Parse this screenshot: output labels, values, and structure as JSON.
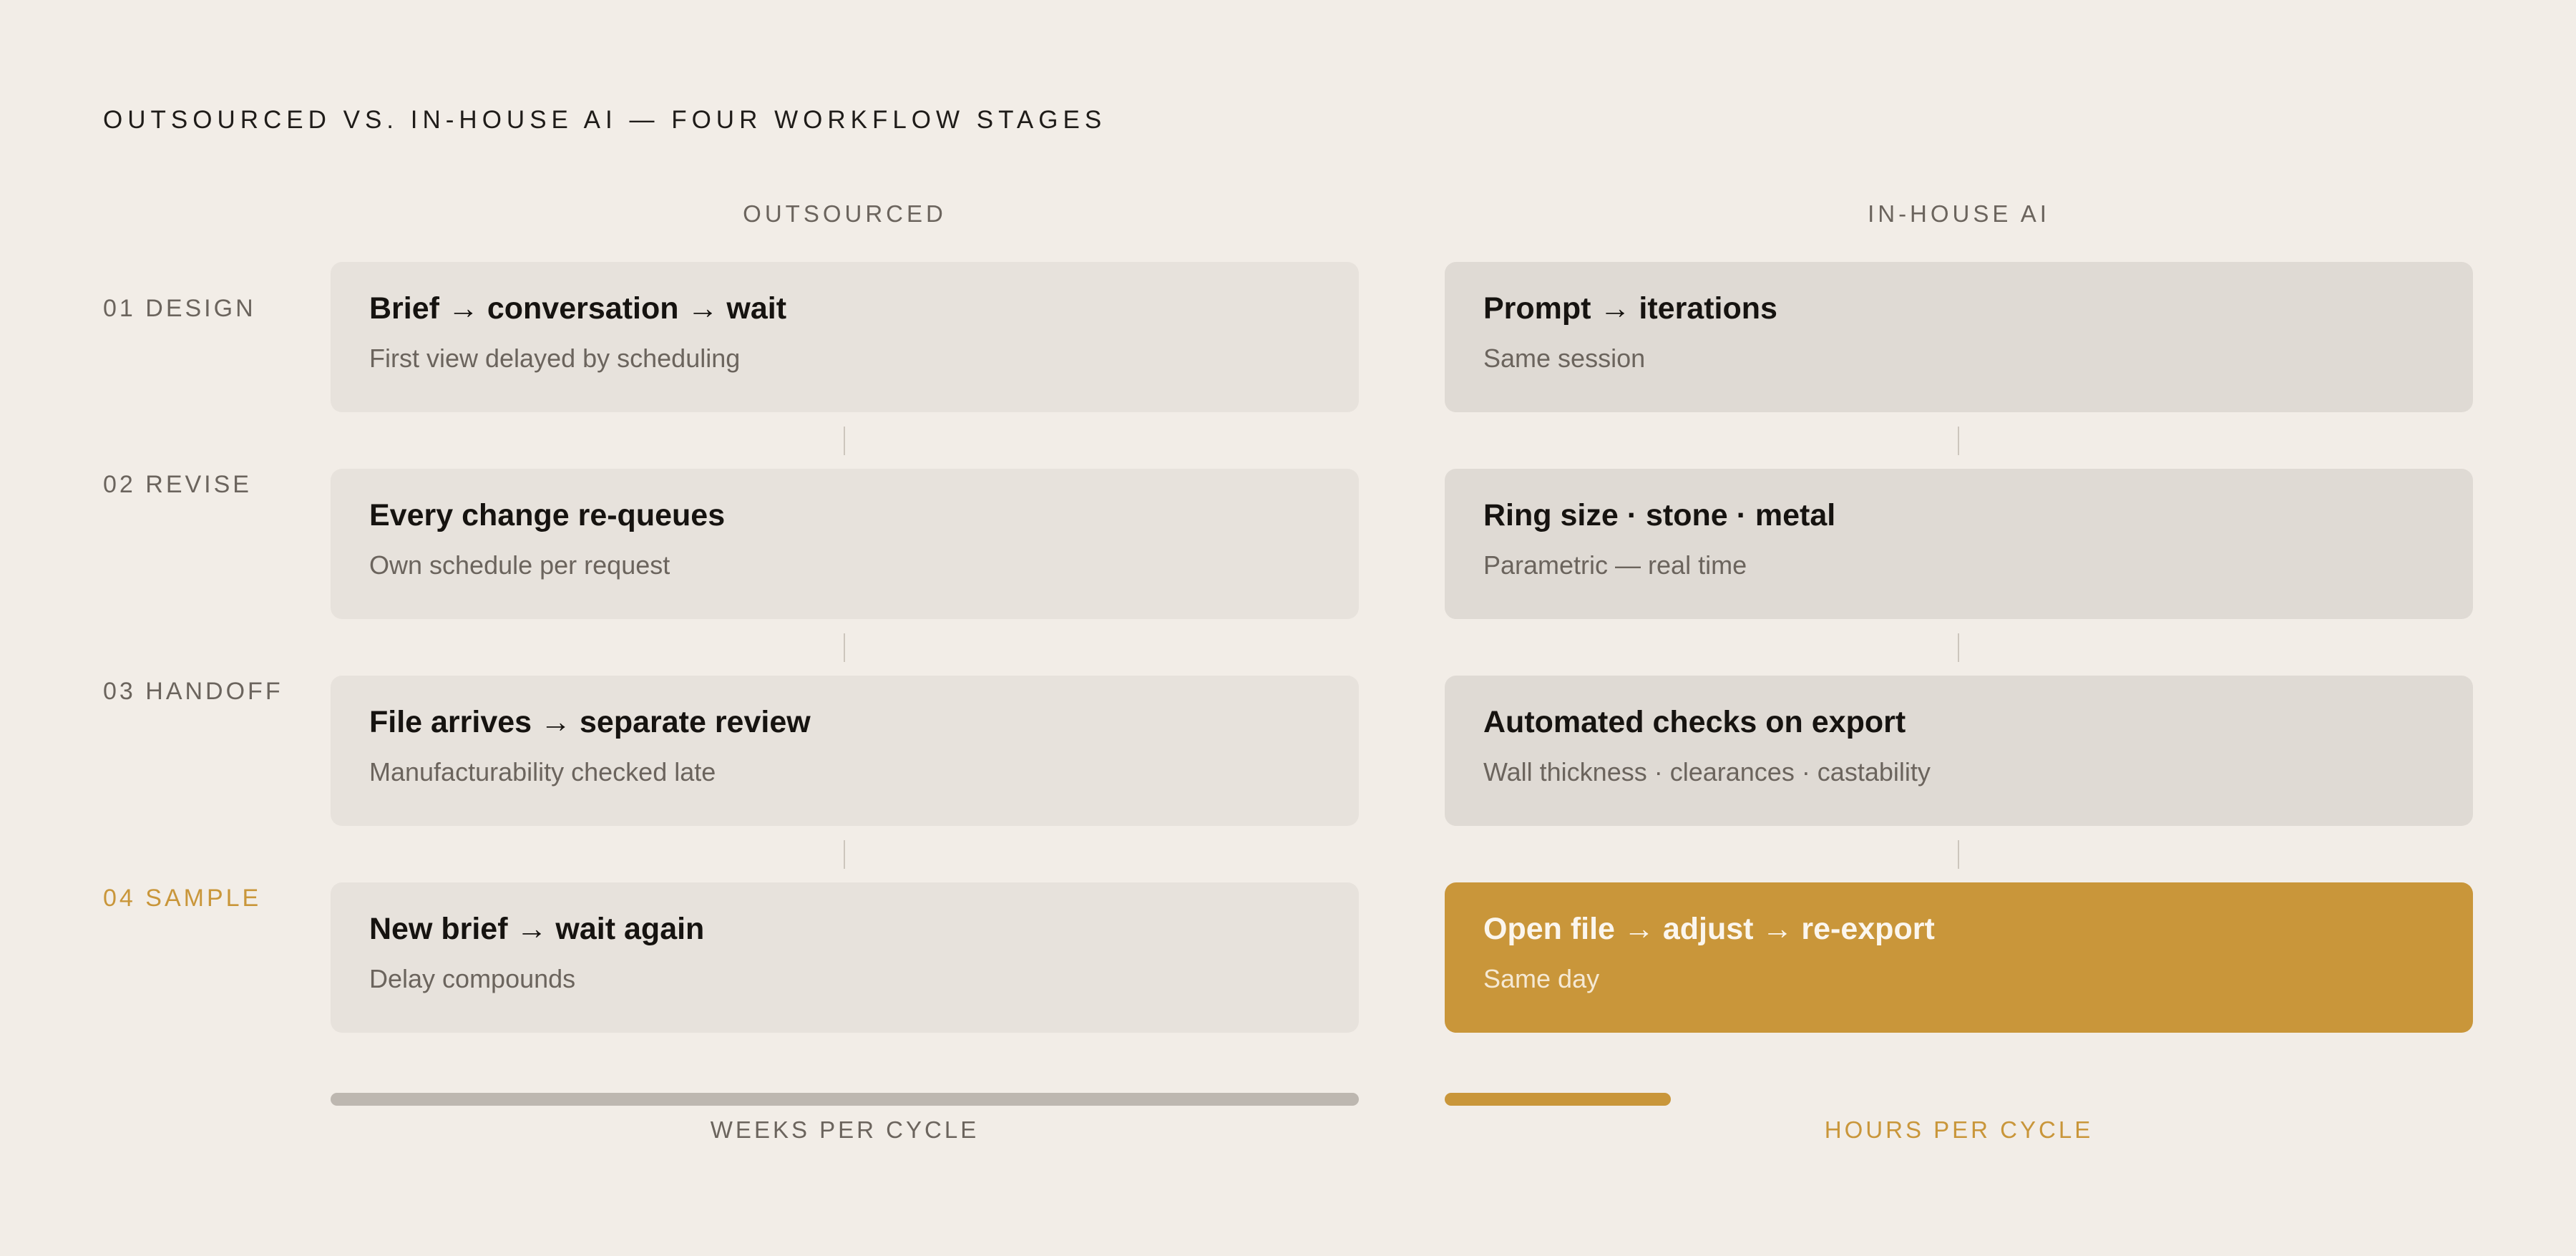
{
  "title": "OUTSOURCED VS. IN-HOUSE AI — FOUR WORKFLOW STAGES",
  "columns": {
    "outsourced": "OUTSOURCED",
    "inhouse": "IN-HOUSE AI"
  },
  "stages": [
    {
      "label": "01 DESIGN",
      "outsourced": {
        "title": "Brief → conversation → wait",
        "sub": "First view delayed by scheduling"
      },
      "inhouse": {
        "title": "Prompt → iterations",
        "sub": "Same session"
      }
    },
    {
      "label": "02 REVISE",
      "outsourced": {
        "title": "Every change re-queues",
        "sub": "Own schedule per request"
      },
      "inhouse": {
        "title": "Ring size · stone · metal",
        "sub": "Parametric — real time"
      }
    },
    {
      "label": "03 HANDOFF",
      "outsourced": {
        "title": "File arrives → separate review",
        "sub": "Manufacturability checked late"
      },
      "inhouse": {
        "title": "Automated checks on export",
        "sub": "Wall thickness · clearances · castability"
      }
    },
    {
      "label": "04 SAMPLE",
      "outsourced": {
        "title": "New brief → wait again",
        "sub": "Delay compounds"
      },
      "inhouse": {
        "title": "Open file → adjust → re-export",
        "sub": "Same day"
      }
    }
  ],
  "cycle": {
    "outsourced_label": "WEEKS PER CYCLE",
    "inhouse_label": "HOURS PER CYCLE",
    "inhouse_fraction": 0.22
  },
  "colors": {
    "background": "#f2ede7",
    "accent": "#c9963a",
    "card_outsourced": "#e7e2dc",
    "card_inhouse": "#dfdad4"
  }
}
